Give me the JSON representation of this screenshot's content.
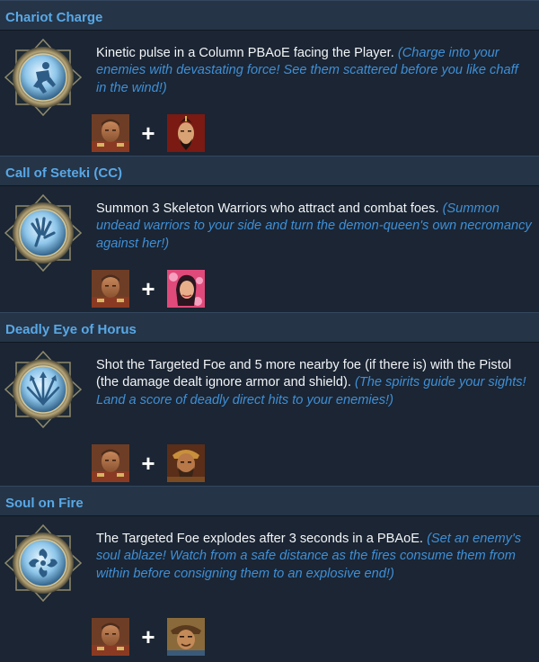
{
  "abilities": [
    {
      "name": "Chariot Charge",
      "description": "Kinetic pulse in a Column PBAoE facing the Player.",
      "flavor": "(Charge into your enemies with devastating force! See them scattered before you like chaff in the wind!)",
      "icon": "chariot-charge-icon",
      "combo_plus": "+",
      "partners": [
        "commander-portrait",
        "warlord-portrait"
      ]
    },
    {
      "name": "Call of Seteki (CC)",
      "description": "Summon 3 Skeleton Warriors who attract and combat foes.",
      "flavor": "(Summon undead warriors to your side and turn the demon-queen's own necromancy against her!)",
      "icon": "skeletal-hand-icon",
      "combo_plus": "+",
      "partners": [
        "commander-portrait",
        "sorceress-portrait"
      ]
    },
    {
      "name": "Deadly Eye of Horus",
      "description": "Shot the Targeted Foe and 5 more nearby foe (if there is) with the Pistol (the damage dealt ignore armor and shield).",
      "flavor": "(The spirits guide your sights! Land a score of deadly direct hits to your enemies!)",
      "icon": "arrow-burst-icon",
      "combo_plus": "+",
      "partners": [
        "commander-portrait",
        "barbarian-portrait"
      ]
    },
    {
      "name": "Soul on Fire",
      "description": "The Targeted Foe explodes after 3 seconds in a PBAoE.",
      "flavor": "(Set an enemy's soul ablaze! Watch from a safe distance as the fires consume them from within before consigning them to an explosive end!)",
      "icon": "spiral-flame-icon",
      "combo_plus": "+",
      "partners": [
        "commander-portrait",
        "adventurer-portrait"
      ]
    }
  ],
  "colors": {
    "background": "#1b2533",
    "header": "#253447",
    "title": "#58a8e6",
    "flavor": "#3f8fd6",
    "text": "#f2f5f8"
  }
}
